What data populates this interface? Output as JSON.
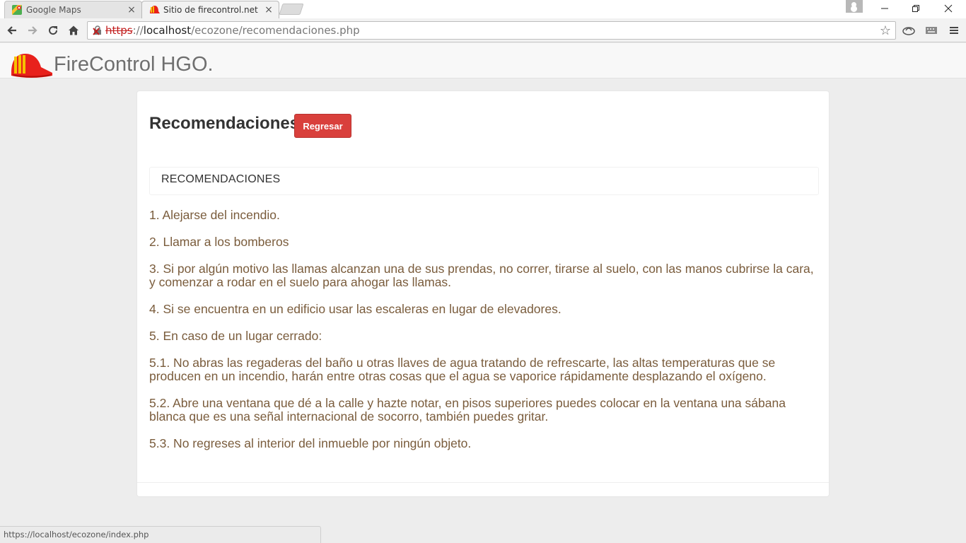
{
  "browser": {
    "tabs": [
      {
        "title": "Google Maps",
        "active": false,
        "icon": "google-maps-icon"
      },
      {
        "title": "Sitio de firecontrol.net",
        "active": true,
        "icon": "firecontrol-icon"
      }
    ],
    "close_glyph": "×",
    "url": {
      "scheme": "https",
      "separator": "://",
      "host": "localhost",
      "path": "/ecozone/recomendaciones.php"
    },
    "status_url": "https://localhost/ecozone/index.php"
  },
  "site": {
    "brand": "FireControl HGO."
  },
  "main": {
    "title": "Recomendaciones",
    "back_button": "Regresar",
    "panel_heading": "RECOMENDACIONES",
    "recommendations": [
      "1. Alejarse del incendio.",
      "2. Llamar a los bomberos",
      "3. Si por algún motivo las llamas alcanzan una de sus prendas, no correr, tirarse al suelo, con las manos cubrirse la cara, y comenzar a rodar en el suelo para ahogar las llamas.",
      "4. Si se encuentra en un edificio usar las escaleras en lugar de elevadores.",
      "5. En caso de un lugar cerrado:",
      "5.1. No abras las regaderas del baño u otras llaves de agua tratando de refrescarte, las altas temperaturas que se producen en un incendio, harán entre otras cosas que el agua se vaporice rápidamente desplazando el oxígeno.",
      "5.2. Abre una ventana que dé a la calle y hazte notar, en pisos superiores puedes colocar en la ventana una sábana blanca que es una señal internacional de socorro, también puedes gritar.",
      "5.3. No regreses al interior del inmueble por ningún objeto."
    ]
  },
  "colors": {
    "accent_button": "#d9403c",
    "recommendation_text": "#7a5c3c",
    "insecure_scheme": "#c21d1d"
  }
}
